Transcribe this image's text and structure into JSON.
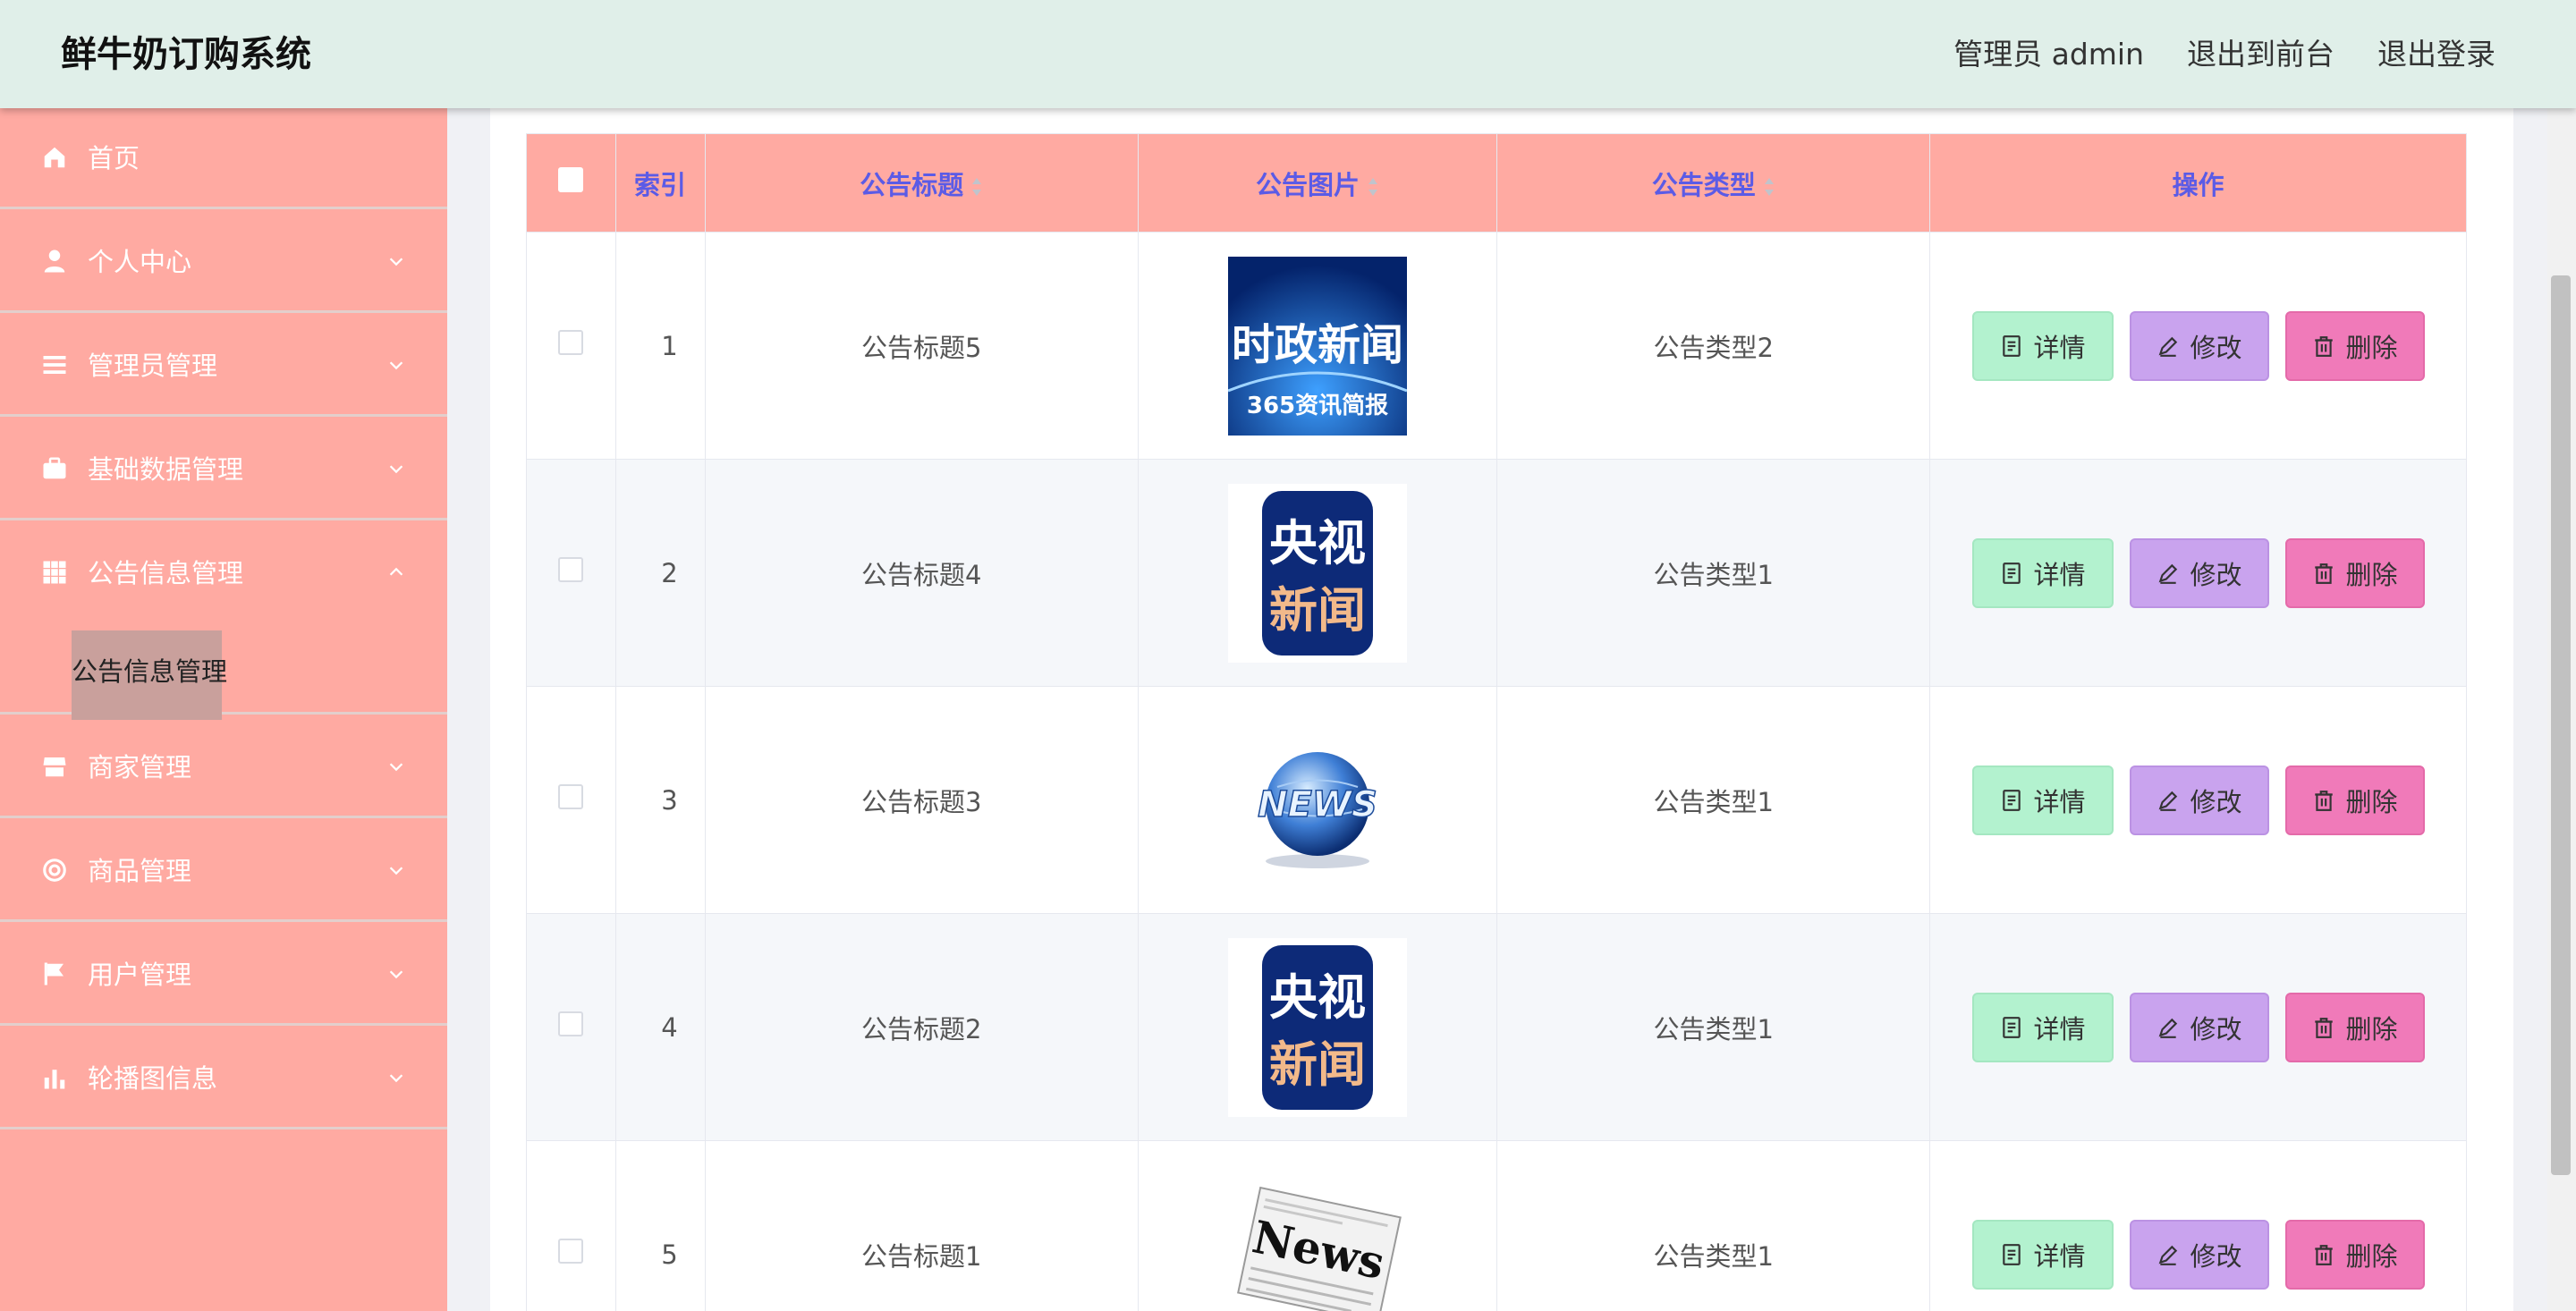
{
  "header": {
    "brand": "鲜牛奶订购系统",
    "nav": [
      "管理员 admin",
      "退出到前台",
      "退出登录"
    ]
  },
  "sidebar": {
    "items": [
      {
        "label": "首页",
        "icon": "home-icon",
        "chevron": false
      },
      {
        "label": "个人中心",
        "icon": "user-icon",
        "chevron": "down"
      },
      {
        "label": "管理员管理",
        "icon": "list-icon",
        "chevron": "down"
      },
      {
        "label": "基础数据管理",
        "icon": "briefcase-icon",
        "chevron": "down"
      },
      {
        "label": "公告信息管理",
        "icon": "grid-icon",
        "chevron": "up"
      },
      {
        "label": "商家管理",
        "icon": "shop-icon",
        "chevron": "down"
      },
      {
        "label": "商品管理",
        "icon": "lifebuoy-icon",
        "chevron": "down"
      },
      {
        "label": "用户管理",
        "icon": "flag-icon",
        "chevron": "down"
      },
      {
        "label": "轮播图信息",
        "icon": "bar-chart-icon",
        "chevron": "down"
      }
    ],
    "active_sub": "公告信息管理"
  },
  "table": {
    "columns": [
      "索引",
      "公告标题",
      "公告图片",
      "公告类型",
      "操作"
    ],
    "rows": [
      {
        "index": "1",
        "title": "公告标题5",
        "image": "news-banner-blue",
        "image_text": [
          "时政新闻",
          "365资讯简报"
        ],
        "type": "公告类型2"
      },
      {
        "index": "2",
        "title": "公告标题4",
        "image": "cctv-news-badge",
        "image_text": [
          "央视",
          "新闻"
        ],
        "type": "公告类型1"
      },
      {
        "index": "3",
        "title": "公告标题3",
        "image": "globe-news",
        "image_text": [
          "NEWS"
        ],
        "type": "公告类型1"
      },
      {
        "index": "4",
        "title": "公告标题2",
        "image": "cctv-news-badge",
        "image_text": [
          "央视",
          "新闻"
        ],
        "type": "公告类型1"
      },
      {
        "index": "5",
        "title": "公告标题1",
        "image": "newspaper",
        "image_text": [
          "News"
        ],
        "type": "公告类型1"
      }
    ],
    "actions": {
      "detail": "详情",
      "edit": "修改",
      "delete": "删除"
    }
  },
  "colors": {
    "header_bg": "#e0efe9",
    "sidebar_bg": "#ffaaa2",
    "table_header_bg": "#ffaaa2",
    "header_text": "#5b5be6",
    "detail_btn": "#b3f2cf",
    "edit_btn": "#c9a3ee",
    "delete_btn": "#f07ab9"
  }
}
